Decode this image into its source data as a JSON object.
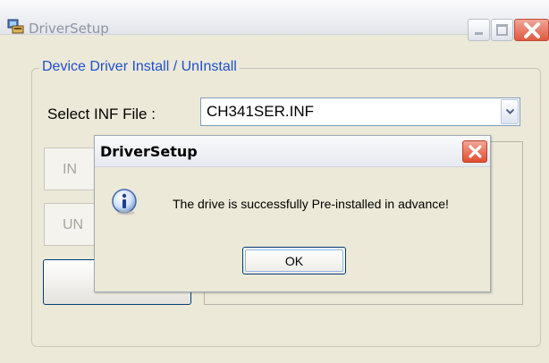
{
  "window": {
    "title": "DriverSetup",
    "icon": "driver-setup-app-icon"
  },
  "group": {
    "legend": "Device Driver Install / UnInstall"
  },
  "inf": {
    "label": "Select INF File :",
    "selected": "CH341SER.INF"
  },
  "buttons": {
    "install_partial": "IN",
    "uninstall_partial": "UN",
    "help_partial": ""
  },
  "dialog": {
    "title": "DriverSetup",
    "message": "The drive is successfully Pre-installed in advance!",
    "ok_label": "OK",
    "icon": "info-icon"
  },
  "colors": {
    "legend_text": "#1f4fd0",
    "close_button": "#e0593f",
    "dialog_bg": "#ece9d8"
  }
}
